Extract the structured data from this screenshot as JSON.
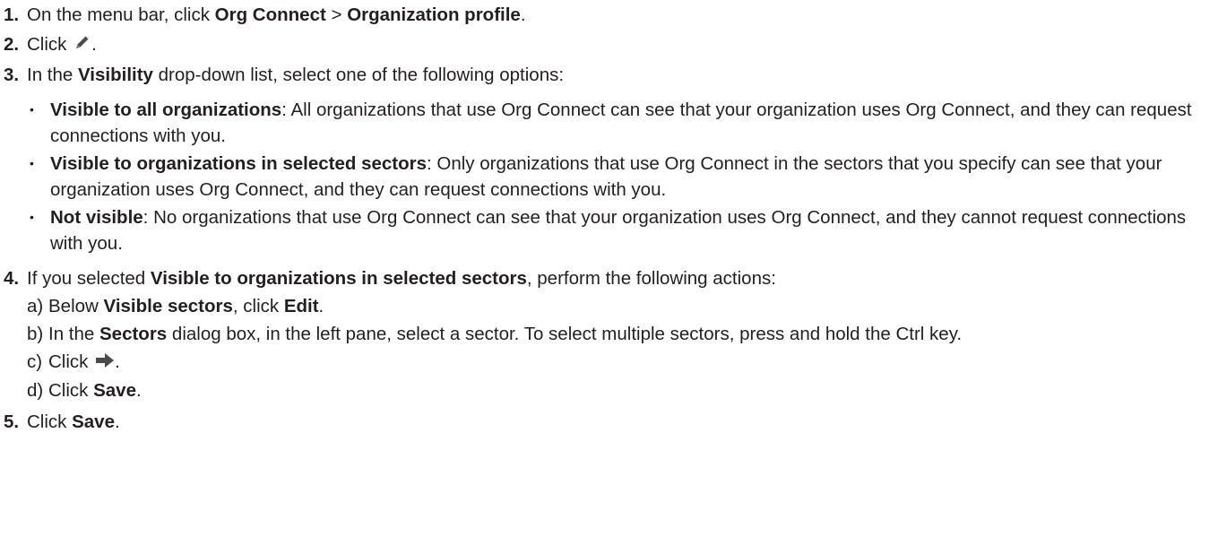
{
  "steps": [
    {
      "num": "1.",
      "parts": [
        "On the menu bar, click ",
        "Org Connect",
        " > ",
        "Organization profile",
        "."
      ]
    },
    {
      "num": "2.",
      "prefix": "Click",
      "icon": "pencil-edit-icon",
      "suffix": "."
    },
    {
      "num": "3.",
      "parts": [
        "In the ",
        "Visibility",
        " drop-down list, select one of the following options:"
      ],
      "options": [
        {
          "label": "Visible to all organizations",
          "text": ": All organizations that use Org Connect can see that your organization uses Org Connect, and they can request connections with you."
        },
        {
          "label": "Visible to organizations in selected sectors",
          "text": ": Only organizations that use Org Connect in the sectors that you specify can see that your organization uses Org Connect, and they can request connections with you."
        },
        {
          "label": "Not visible",
          "text": ": No organizations that use Org Connect can see that your organization uses Org Connect, and they cannot request connections with you."
        }
      ]
    },
    {
      "num": "4.",
      "parts": [
        "If you selected ",
        "Visible to organizations in selected sectors",
        ", perform the following actions:"
      ],
      "substeps": [
        {
          "label": "a)",
          "parts": [
            "Below ",
            "Visible sectors",
            ", click ",
            "Edit",
            "."
          ]
        },
        {
          "label": "b)",
          "parts": [
            "In the ",
            "Sectors",
            " dialog box, in the left pane, select a sector. To select multiple sectors, press and hold the Ctrl key."
          ]
        },
        {
          "label": "c)",
          "prefix": "Click",
          "icon": "arrow-right-icon",
          "suffix": "."
        },
        {
          "label": "d)",
          "parts": [
            "Click ",
            "Save",
            "."
          ]
        }
      ]
    },
    {
      "num": "5.",
      "parts": [
        "Click ",
        "Save",
        "."
      ]
    }
  ],
  "bullet_glyph": "•",
  "colors": {
    "text": "#231f20",
    "icon": "#4a4a4a"
  }
}
